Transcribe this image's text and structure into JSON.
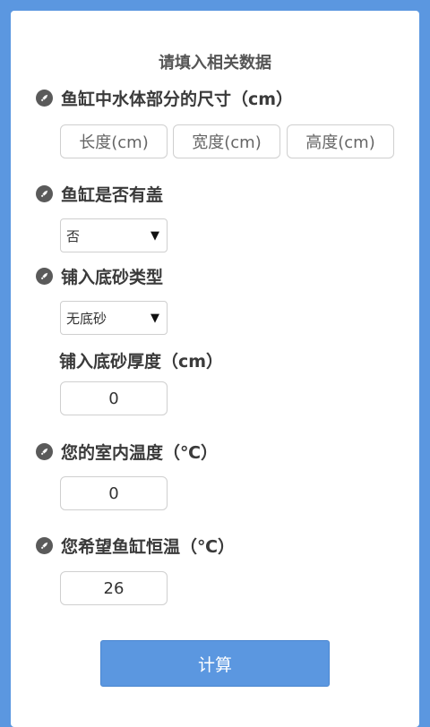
{
  "form": {
    "title": "请填入相关数据",
    "tank_size": {
      "label": "鱼缸中水体部分的尺寸（cm）",
      "length_placeholder": "长度(cm)",
      "width_placeholder": "宽度(cm)",
      "height_placeholder": "高度(cm)"
    },
    "lid": {
      "label": "鱼缸是否有盖",
      "selected": "否"
    },
    "substrate": {
      "label": "铺入底砂类型",
      "selected": "无底砂",
      "thickness_label": "铺入底砂厚度（cm）",
      "thickness_value": "0"
    },
    "room_temp": {
      "label": "您的室内温度（℃）",
      "value": "0"
    },
    "target_temp": {
      "label": "您希望鱼缸恒温（℃）",
      "value": "26"
    },
    "calculate_label": "计算"
  },
  "icons": {
    "section_icon": "rocket-icon",
    "dropdown_icon": "triangle-down-icon"
  },
  "colors": {
    "background": "#5b97e0",
    "button": "#5b97e0"
  }
}
